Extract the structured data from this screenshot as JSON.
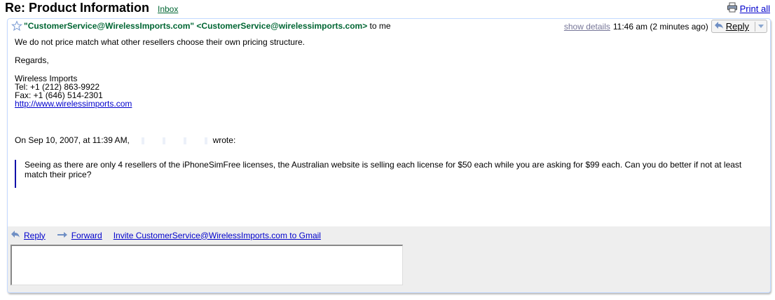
{
  "subject": "Re: Product Information",
  "label": "Inbox",
  "print_all": "Print all",
  "header": {
    "from": "\"CustomerService@WirelessImports.com\" <CustomerService@wirelessimports.com>",
    "to": "to me",
    "show_details": "show details",
    "time": "11:46 am (2 minutes ago)",
    "reply": "Reply"
  },
  "body": {
    "line1": "We do not price match what other resellers choose their own pricing structure.",
    "regards": "Regards,",
    "sig_name": "Wireless Imports",
    "sig_tel": "Tel: +1 (212) 863-9922",
    "sig_fax": "Fax: +1 (646) 514-2301",
    "sig_url": "http://www.wirelessimports.com",
    "quote_intro_prefix": "On Sep 10, 2007, at 11:39 AM,",
    "quote_intro_suffix": "wrote:",
    "quote": "Seeing as there are only 4 resellers of the iPhoneSimFree licenses, the Australian website is selling each license for $50 each while you are asking for $99 each. Can you do better if not at least match their price?"
  },
  "footer": {
    "reply": "Reply",
    "forward": "Forward",
    "invite": "Invite CustomerService@WirelessImports.com to Gmail"
  },
  "colors": {
    "sender_green": "#006633",
    "link_blue": "#0000cc",
    "footer_bg": "#eeeeee",
    "quote_bar": "#1010aa"
  },
  "icons": [
    "printer-icon",
    "star-icon",
    "reply-arrow-icon",
    "dropdown-arrow-icon",
    "forward-arrow-icon"
  ]
}
